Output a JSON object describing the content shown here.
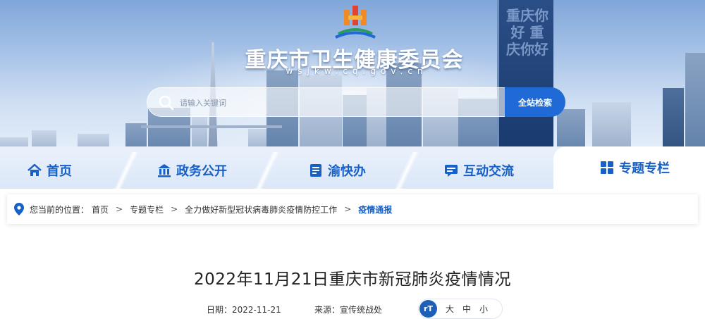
{
  "header": {
    "site_title": "重庆市卫生健康委员会",
    "site_domain": "wsjkw.cq.gov.cn",
    "tower_text": "重庆你好 重庆你好"
  },
  "search": {
    "placeholder": "请输入关键词",
    "button_label": "全站检索"
  },
  "nav": {
    "items": [
      {
        "label": "首页",
        "icon": "home-icon"
      },
      {
        "label": "政务公开",
        "icon": "government-icon"
      },
      {
        "label": "渝快办",
        "icon": "document-icon"
      },
      {
        "label": "互动交流",
        "icon": "chat-icon"
      },
      {
        "label": "专题专栏",
        "icon": "grid-icon"
      }
    ]
  },
  "breadcrumb": {
    "prefix": "您当前的位置：",
    "items": [
      "首页",
      "专题专栏",
      "全力做好新型冠状病毒肺炎疫情防控工作",
      "疫情通报"
    ],
    "separator": ">"
  },
  "article": {
    "title": "2022年11月21日重庆市新冠肺炎疫情情况",
    "date_label": "日期：2022-11-21",
    "source_label": "来源：宣传统战处",
    "font_icon_text": "rT",
    "font_sizes": [
      "大",
      "中",
      "小"
    ]
  },
  "colors": {
    "primary": "#1660c8",
    "search_button": "#1f6ad6"
  }
}
